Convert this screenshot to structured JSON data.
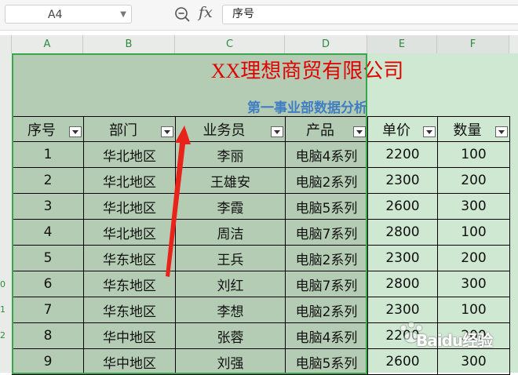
{
  "formula_bar": {
    "name_box": "A4",
    "fx_label": "fx",
    "formula_value": "序号"
  },
  "columns": [
    "A",
    "B",
    "C",
    "D",
    "E",
    "F"
  ],
  "row_numbers": [
    "0",
    "1",
    "2"
  ],
  "sheet": {
    "title": "XX理想商贸有限公司",
    "subtitle": "第一事业部数据分析",
    "headers": [
      "序号",
      "部门",
      "业务员",
      "产品",
      "单价",
      "数量"
    ],
    "rows": [
      [
        "1",
        "华北地区",
        "李丽",
        "电脑4系列",
        "2200",
        "100"
      ],
      [
        "2",
        "华北地区",
        "王雄安",
        "电脑2系列",
        "2300",
        "200"
      ],
      [
        "3",
        "华北地区",
        "李霞",
        "电脑5系列",
        "2600",
        "300"
      ],
      [
        "4",
        "华北地区",
        "周洁",
        "电脑7系列",
        "2800",
        "100"
      ],
      [
        "5",
        "华东地区",
        "王兵",
        "电脑2系列",
        "2300",
        "200"
      ],
      [
        "6",
        "华东地区",
        "刘红",
        "电脑7系列",
        "2800",
        "300"
      ],
      [
        "7",
        "华东地区",
        "李想",
        "电脑2系列",
        "2300",
        "100"
      ],
      [
        "8",
        "华中地区",
        "张蓉",
        "电脑4系列",
        "2200",
        "200"
      ],
      [
        "9",
        "华中地区",
        "刘强",
        "电脑5系列",
        "2600",
        "300"
      ]
    ]
  },
  "watermark": "Baidu经验",
  "colors": {
    "title": "#e00000",
    "subtitle": "#3f7ec2",
    "selection_border": "#3aa64b",
    "arrow": "#e8231a"
  }
}
